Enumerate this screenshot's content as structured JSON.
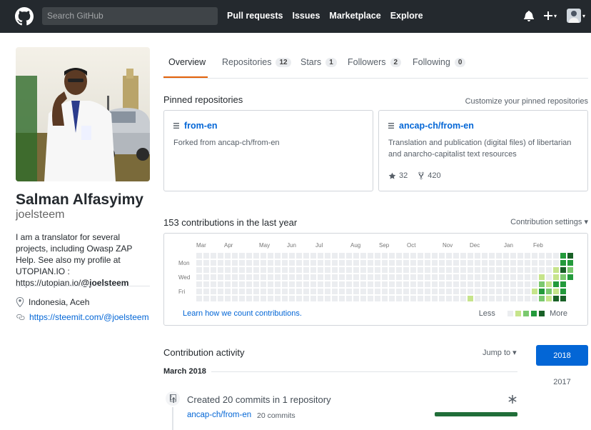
{
  "header": {
    "search_placeholder": "Search GitHub",
    "nav": [
      "Pull requests",
      "Issues",
      "Marketplace",
      "Explore"
    ],
    "plus_caret": "▾",
    "avatar_caret": "▾"
  },
  "profile": {
    "fullname": "Salman Alfasyimy",
    "username": "joelsteem",
    "bio_1": "I am a translator for several projects, including Owasp ZAP Help. See also my profile at UTOPIAN.IO : https://utopian.io/",
    "bio_handle": "@joelsteem",
    "location": "Indonesia, Aceh",
    "website": "https://steemit.com/@joelsteem"
  },
  "tabs": [
    {
      "label": "Overview",
      "count": null
    },
    {
      "label": "Repositories",
      "count": "12"
    },
    {
      "label": "Stars",
      "count": "1"
    },
    {
      "label": "Followers",
      "count": "2"
    },
    {
      "label": "Following",
      "count": "0"
    }
  ],
  "pinned": {
    "title": "Pinned repositories",
    "customize": "Customize your pinned repositories",
    "cards": [
      {
        "name": "from-en",
        "desc": "Forked from ancap-ch/from-en",
        "stars": "",
        "forks": ""
      },
      {
        "name": "ancap-ch/from-en",
        "desc": "Translation and publication (digital files) of libertarian and anarcho-capitalist text resources",
        "stars": "32",
        "forks": "420"
      }
    ]
  },
  "contributions": {
    "title": "153 contributions in the last year",
    "settings": "Contribution settings ▾",
    "months": [
      "Mar",
      "Apr",
      "May",
      "Jun",
      "Jul",
      "Aug",
      "Sep",
      "Oct",
      "Nov",
      "Dec",
      "Jan",
      "Feb"
    ],
    "days": [
      "Mon",
      "Wed",
      "Fri"
    ],
    "learn": "Learn how we count contributions.",
    "less": "Less",
    "more": "More",
    "colors": [
      "#ebedf0",
      "#c6e48b",
      "#7bc96f",
      "#239a3b",
      "#196127"
    ]
  },
  "activity": {
    "title": "Contribution activity",
    "jump": "Jump to ▾",
    "month": "March 2018",
    "years": [
      "2018",
      "2017"
    ],
    "commit_title": "Created 20 commits in 1 repository",
    "commit_repo": "ancap-ch/from-en",
    "commit_count": "20 commits"
  }
}
